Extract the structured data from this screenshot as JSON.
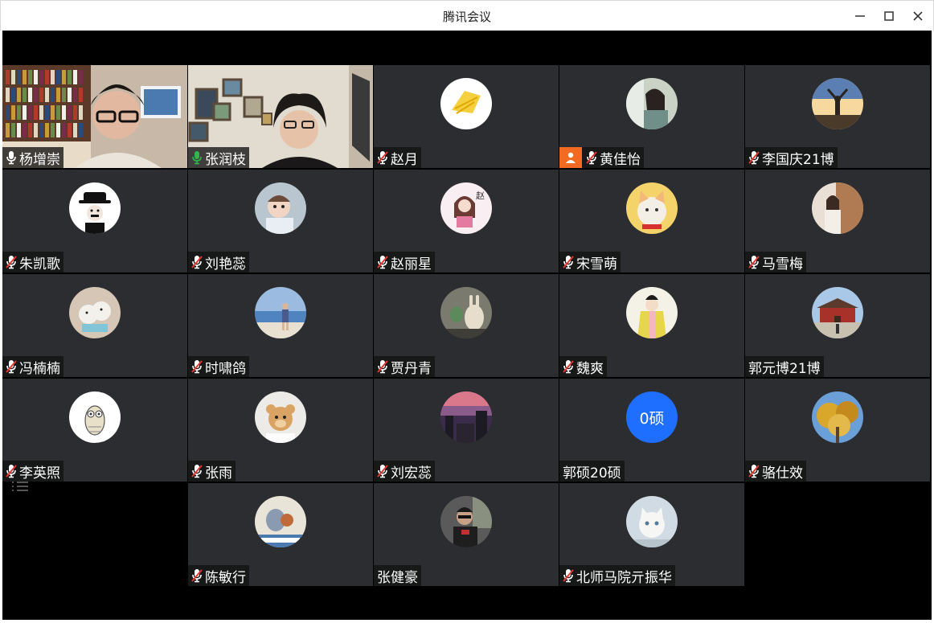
{
  "window": {
    "title": "腾讯会议",
    "controls": [
      "minimize-icon",
      "maximize-icon",
      "close-icon"
    ]
  },
  "colors": {
    "tile_bg": "#2c2d30",
    "stage_bg": "#000000",
    "mic_on": "#2db84d",
    "mic_muted_slash": "#e8362f",
    "camera_off_badge": "#f26b21",
    "text_avatar_bg": "#1e6fff",
    "active_speaker_border": "#2db84d"
  },
  "participants": [
    {
      "name": "杨增崇",
      "mic": "on-white",
      "video": true,
      "avatar_icon": "video-feed-bookshelf-man"
    },
    {
      "name": "张润枝",
      "mic": "on-green",
      "video": true,
      "avatar_icon": "video-feed-woman-wall-frames",
      "active_speaker": true
    },
    {
      "name": "赵月",
      "mic": "muted",
      "avatar_icon": "yellow-drawing-avatar"
    },
    {
      "name": "黄佳怡",
      "mic": "muted",
      "camera_off": true,
      "avatar_icon": "girl-portrait-avatar"
    },
    {
      "name": "李国庆21博",
      "mic": "muted",
      "avatar_icon": "sunset-silhouette-avatar"
    },
    {
      "name": "朱凯歌",
      "mic": "muted",
      "avatar_icon": "chaplin-avatar"
    },
    {
      "name": "刘艳蕊",
      "mic": "muted",
      "avatar_icon": "baby-photo-avatar"
    },
    {
      "name": "赵丽星",
      "mic": "muted",
      "avatar_icon": "cartoon-girl-avatar"
    },
    {
      "name": "宋雪萌",
      "mic": "muted",
      "avatar_icon": "cat-avatar"
    },
    {
      "name": "马雪梅",
      "mic": "muted",
      "avatar_icon": "woman-doorway-avatar"
    },
    {
      "name": "冯楠楠",
      "mic": "muted",
      "avatar_icon": "plush-toys-avatar"
    },
    {
      "name": "时啸鸽",
      "mic": "muted",
      "avatar_icon": "beach-person-avatar"
    },
    {
      "name": "贾丹青",
      "mic": "muted",
      "avatar_icon": "bunny-toys-avatar"
    },
    {
      "name": "魏爽",
      "mic": "muted",
      "avatar_icon": "costume-girl-avatar"
    },
    {
      "name": "郭元博21博",
      "mic": "none",
      "avatar_icon": "palace-gate-avatar"
    },
    {
      "name": "李英照",
      "mic": "muted",
      "avatar_icon": "owl-sketch-avatar"
    },
    {
      "name": "张雨",
      "mic": "muted",
      "avatar_icon": "teddy-bear-avatar"
    },
    {
      "name": "刘宏蕊",
      "mic": "muted",
      "avatar_icon": "dusk-sky-avatar"
    },
    {
      "name": "郭硕20硕",
      "mic": "none",
      "avatar_text": "0硕"
    },
    {
      "name": "骆仕效",
      "mic": "muted",
      "avatar_icon": "autumn-tree-avatar"
    },
    {
      "name": "",
      "empty": true
    },
    {
      "name": "陈敏行",
      "mic": "muted",
      "avatar_icon": "tom-jerry-avatar"
    },
    {
      "name": "张健豪",
      "mic": "none",
      "avatar_icon": "man-portrait-avatar"
    },
    {
      "name": "北师马院亓振华",
      "mic": "muted",
      "avatar_icon": "white-kitten-avatar"
    },
    {
      "name": "",
      "empty": true
    }
  ]
}
